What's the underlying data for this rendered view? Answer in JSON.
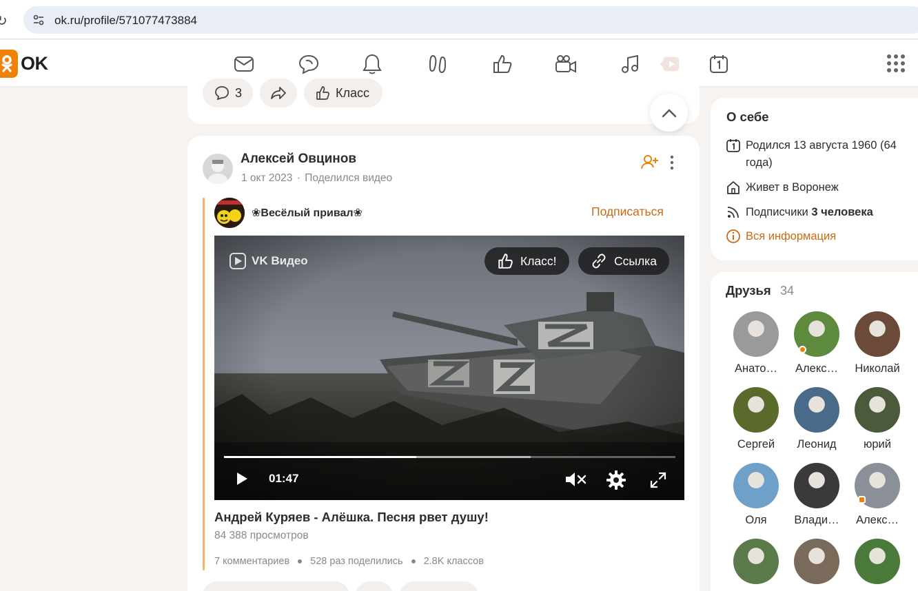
{
  "browser": {
    "url_host": "ok.ru",
    "url_path": "/profile/571077473884"
  },
  "nav": {
    "logo_text": "OK",
    "icons": [
      "messages-icon",
      "discussions-icon",
      "notifications-icon",
      "guests-icon",
      "marks-icon",
      "video-icon",
      "music-icon",
      "vk-video-icon",
      "events-icon",
      "apps-grid-icon"
    ]
  },
  "prev_post": {
    "comments_count": "3",
    "like_label": "Класс"
  },
  "post": {
    "author": "Алексей Овцинов",
    "date": "1 окт 2023",
    "action": "Поделился видео",
    "group_name": "❀Весёлый привал❀",
    "subscribe_label": "Подписаться",
    "video": {
      "brand": "VK Видео",
      "like_label": "Класс!",
      "link_label": "Ссылка",
      "time": "01:47",
      "progress": 0.426,
      "buffered": 0.68
    },
    "title": "Андрей Куряев - Алёшка. Песня рвет душу!",
    "views": "84 388 просмотров",
    "stats": {
      "comments": "7 комментариев",
      "shares": "528 раз поделились",
      "likes": "2.8K классов"
    }
  },
  "about": {
    "title": "О себе",
    "born": "Родился 13 августа 1960 (64 года)",
    "lives": "Живет в Воронеж",
    "subscribers_prefix": "Подписчики",
    "subscribers_value": "3 человека",
    "all_info": "Вся информация"
  },
  "friends": {
    "title": "Друзья",
    "count": "34",
    "items": [
      {
        "name": "Анато…",
        "color": "#9a9a9a"
      },
      {
        "name": "Алекс…",
        "color": "#5d8a3c"
      },
      {
        "name": "Николай",
        "color": "#6b4a3a"
      },
      {
        "name": "Сергей",
        "color": "#5a6a2a"
      },
      {
        "name": "Леонид",
        "color": "#4a6a8a"
      },
      {
        "name": "юрий",
        "color": "#4a5a3a"
      },
      {
        "name": "Оля",
        "color": "#6ea0c8"
      },
      {
        "name": "Влади…",
        "color": "#3a3a3a"
      },
      {
        "name": "Алекс…",
        "color": "#8a8f98"
      },
      {
        "name": "",
        "color": "#5a7a4a"
      },
      {
        "name": "",
        "color": "#7a6a5a"
      },
      {
        "name": "",
        "color": "#4a7a3a"
      }
    ]
  },
  "colors": {
    "accent": "#ee8208",
    "link": "#c96b12",
    "share_bar": "#f3b36a"
  }
}
